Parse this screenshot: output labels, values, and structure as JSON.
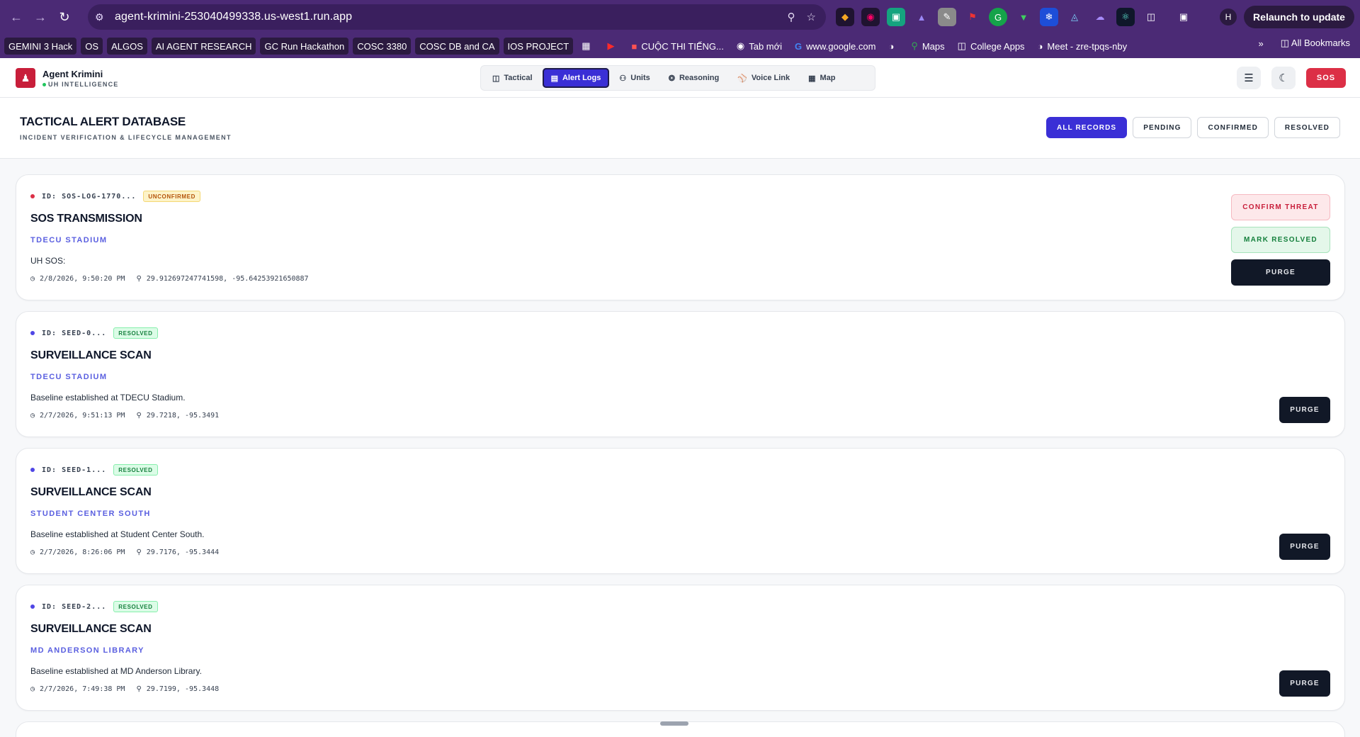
{
  "browser": {
    "url": "agent-krimini-253040499338.us-west1.run.app",
    "profile_initial": "H",
    "relaunch_label": "Relaunch to update",
    "bookmarks": [
      {
        "label": "GEMINI 3 Hack",
        "chip": true
      },
      {
        "label": "OS",
        "chip": true
      },
      {
        "label": "ALGOS",
        "chip": true
      },
      {
        "label": "AI AGENT RESEARCH",
        "chip": true
      },
      {
        "label": "GC Run Hackathon",
        "chip": true
      },
      {
        "label": "COSC 3380",
        "chip": true
      },
      {
        "label": "COSC DB and CA",
        "chip": true
      },
      {
        "label": "IOS PROJECT",
        "chip": true
      },
      {
        "label": "CUỘC THI TIẾNG...",
        "chip": false
      },
      {
        "label": "Tab mới",
        "chip": false
      },
      {
        "label": "www.google.com",
        "chip": false
      },
      {
        "label": "Maps",
        "chip": false
      },
      {
        "label": "College Apps",
        "chip": false
      },
      {
        "label": "Meet - zre-tpqs-nby",
        "chip": false
      }
    ],
    "all_bookmarks_label": "All Bookmarks"
  },
  "app": {
    "name": "Agent Krimini",
    "subtitle": "UH INTELLIGENCE",
    "sos_label": "SOS",
    "tabs": [
      {
        "label": "Tactical",
        "icon": "map-grid-icon",
        "active": false
      },
      {
        "label": "Alert Logs",
        "icon": "database-icon",
        "active": true
      },
      {
        "label": "Units",
        "icon": "users-icon",
        "active": false
      },
      {
        "label": "Reasoning",
        "icon": "brain-icon",
        "active": false
      },
      {
        "label": "Voice Link",
        "icon": "mic-icon",
        "active": false
      },
      {
        "label": "Map",
        "icon": "map-icon",
        "active": false
      }
    ]
  },
  "section": {
    "title": "TACTICAL ALERT DATABASE",
    "subtitle": "INCIDENT VERIFICATION & LIFECYCLE MANAGEMENT",
    "filters": [
      {
        "label": "ALL RECORDS",
        "active": true
      },
      {
        "label": "PENDING",
        "active": false
      },
      {
        "label": "CONFIRMED",
        "active": false
      },
      {
        "label": "RESOLVED",
        "active": false
      }
    ]
  },
  "records": [
    {
      "id": "ID: SOS-LOG-1770...",
      "status": "UNCONFIRMED",
      "dot_color": "#dc2f46",
      "title": "SOS TRANSMISSION",
      "location": "TDECU STADIUM",
      "description": "UH SOS:",
      "timestamp": "2/8/2026, 9:50:20 PM",
      "coords": "29.912697247741598, -95.64253921650887",
      "confirm_label": "CONFIRM THREAT",
      "resolve_label": "MARK RESOLVED",
      "purge_label": "PURGE"
    },
    {
      "id": "ID: SEED-0...",
      "status": "RESOLVED",
      "dot_color": "#4f46e5",
      "title": "SURVEILLANCE SCAN",
      "location": "TDECU STADIUM",
      "description": "Baseline established at TDECU Stadium.",
      "timestamp": "2/7/2026, 9:51:13 PM",
      "coords": "29.7218, -95.3491",
      "purge_label": "PURGE"
    },
    {
      "id": "ID: SEED-1...",
      "status": "RESOLVED",
      "dot_color": "#4f46e5",
      "title": "SURVEILLANCE SCAN",
      "location": "STUDENT CENTER SOUTH",
      "description": "Baseline established at Student Center South.",
      "timestamp": "2/7/2026, 8:26:06 PM",
      "coords": "29.7176, -95.3444",
      "purge_label": "PURGE"
    },
    {
      "id": "ID: SEED-2...",
      "status": "RESOLVED",
      "dot_color": "#4f46e5",
      "title": "SURVEILLANCE SCAN",
      "location": "MD ANDERSON LIBRARY",
      "description": "Baseline established at MD Anderson Library.",
      "timestamp": "2/7/2026, 7:49:38 PM",
      "coords": "29.7199, -95.3448",
      "purge_label": "PURGE"
    }
  ]
}
